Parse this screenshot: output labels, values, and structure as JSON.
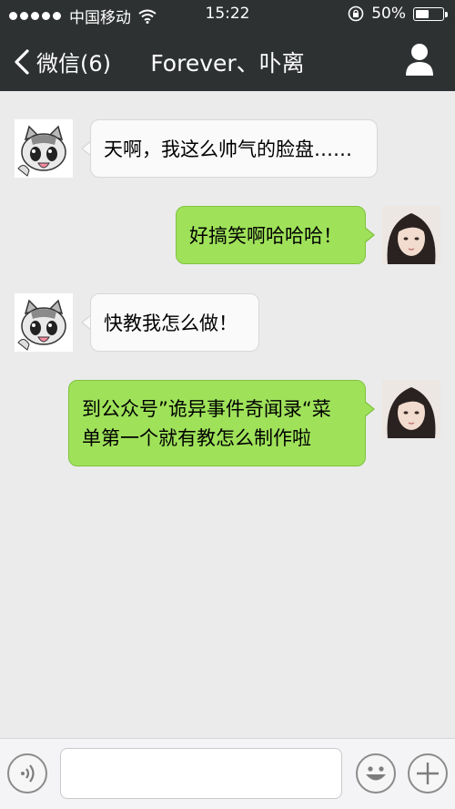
{
  "status_bar": {
    "carrier": "中国移动",
    "time": "15:22",
    "battery_percent": "50%",
    "battery_level": 0.5,
    "wifi_icon": "wifi-icon",
    "lock_icon": "orientation-lock-icon"
  },
  "nav": {
    "back_label": "微信(6)",
    "title": "Forever、卟离",
    "back_icon": "chevron-left-icon",
    "profile_icon": "person-icon"
  },
  "messages": [
    {
      "side": "in",
      "text": "天啊，我这么帅气的脸盘……"
    },
    {
      "side": "out",
      "text": "好搞笑啊哈哈哈！"
    },
    {
      "side": "in",
      "text": "快教我怎么做！"
    },
    {
      "side": "out",
      "text_lines": [
        "到公众号”诡异事件奇闻录“菜",
        "单第一个就有教怎么制作啦"
      ]
    }
  ],
  "bottom_bar": {
    "voice_icon": "voice-icon",
    "emoji_icon": "emoji-icon",
    "plus_icon": "plus-icon",
    "input_value": ""
  },
  "colors": {
    "nav_bg": "#2e3132",
    "chat_bg": "#ebebeb",
    "outgoing_bubble": "#9fe25a",
    "incoming_bubble": "#fafafa"
  }
}
